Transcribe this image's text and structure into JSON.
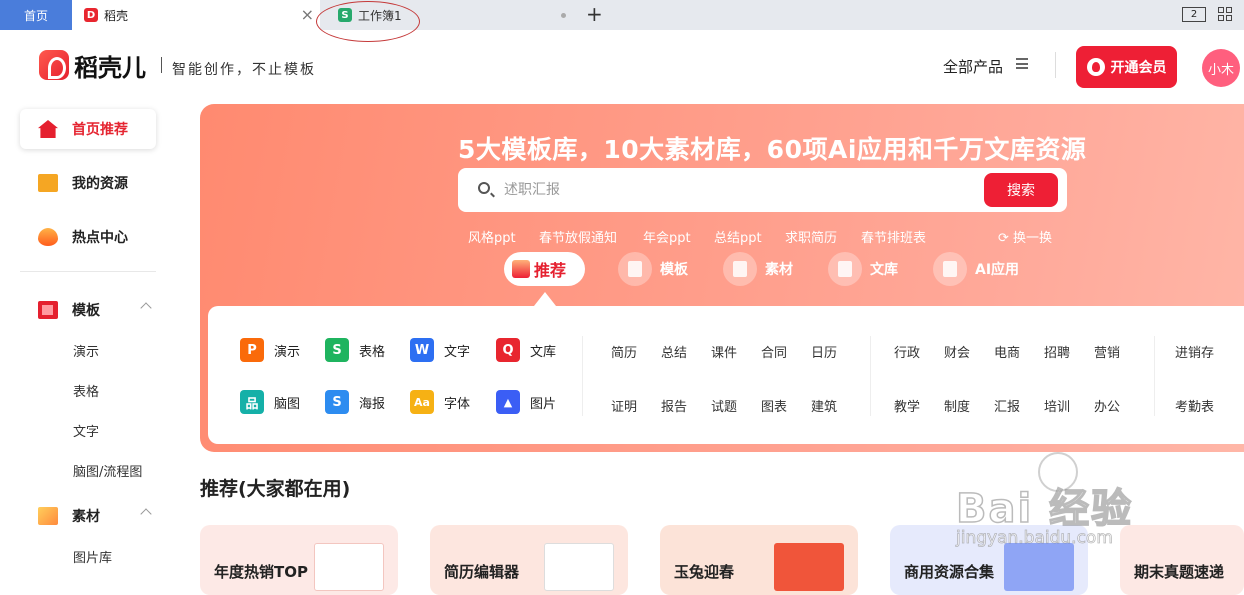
{
  "tabbar": {
    "home_tab": "首页",
    "doc_tab": "稻壳",
    "sheet_tab": "工作簿1",
    "doc_logo": "D",
    "sheet_logo": "S",
    "close_glyph": "×",
    "add_glyph": "+",
    "window_badge": "2"
  },
  "header": {
    "brand": "稻壳儿",
    "slogan": "智能创作，不止模板",
    "all_products": "全部产品",
    "vip_button": "开通会员",
    "avatar_text": "小木"
  },
  "sidebar": {
    "items": [
      {
        "label": "首页推荐",
        "icon": "home-icon"
      },
      {
        "label": "我的资源",
        "icon": "folder-icon"
      },
      {
        "label": "热点中心",
        "icon": "fire-icon"
      }
    ],
    "templates": {
      "label": "模板",
      "icon": "template-icon",
      "subitems": [
        "演示",
        "表格",
        "文字",
        "脑图/流程图"
      ]
    },
    "materials": {
      "label": "素材",
      "icon": "material-icon",
      "subitems": [
        "图片库"
      ]
    }
  },
  "banner": {
    "title": "5大模板库，10大素材库，60项Ai应用和千万文库资源",
    "search_placeholder": "述职汇报",
    "search_button": "搜索",
    "hot_words": [
      "风格ppt",
      "春节放假通知",
      "年会ppt",
      "总结ppt",
      "求职简历",
      "春节排班表"
    ],
    "refresh_label": "换一换",
    "categories": [
      "推荐",
      "模板",
      "素材",
      "文库",
      "AI应用"
    ]
  },
  "panel": {
    "apps": [
      {
        "label": "演示",
        "glyph": "P",
        "color": "#fa6a0a"
      },
      {
        "label": "表格",
        "glyph": "S",
        "color": "#1fb45f"
      },
      {
        "label": "文字",
        "glyph": "W",
        "color": "#2d6ff2"
      },
      {
        "label": "文库",
        "glyph": "Q",
        "color": "#e8262f"
      },
      {
        "label": "脑图",
        "glyph": "品",
        "color": "#15b0a8"
      },
      {
        "label": "海报",
        "glyph": "S",
        "color": "#2d8cf0"
      },
      {
        "label": "字体",
        "glyph": "Aa",
        "color": "#f6b114"
      },
      {
        "label": "图片",
        "glyph": "▲",
        "color": "#3b5ef5"
      }
    ],
    "group1": [
      "简历",
      "总结",
      "课件",
      "合同",
      "日历",
      "证明",
      "报告",
      "试题",
      "图表",
      "建筑"
    ],
    "group2": [
      "行政",
      "财会",
      "电商",
      "招聘",
      "营销",
      "教学",
      "制度",
      "汇报",
      "培训",
      "办公"
    ],
    "group3": [
      "进销存",
      "考勤表"
    ]
  },
  "recommend": {
    "title": "推荐(大家都在用)",
    "cards": [
      "年度热销TOP",
      "简历编辑器",
      "玉兔迎春",
      "商用资源合集",
      "期末真题速递"
    ]
  },
  "watermark": {
    "brand": "Bai 经验",
    "url": "jingyan.baidu.com"
  }
}
